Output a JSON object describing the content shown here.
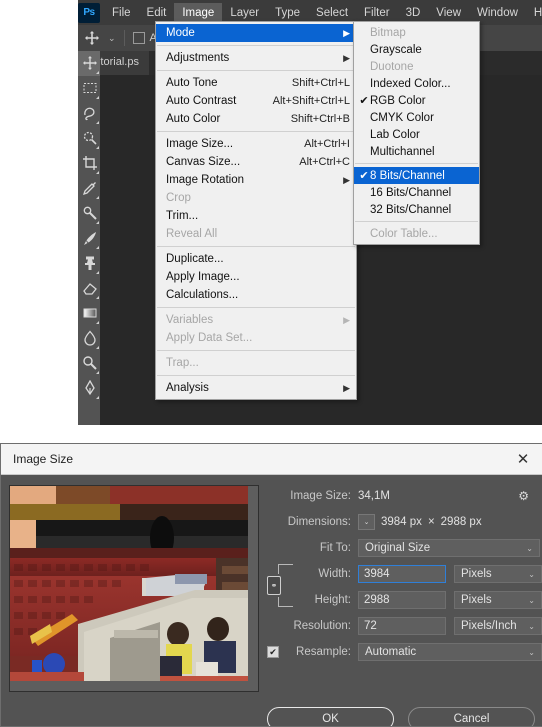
{
  "app": {
    "logo": "Ps",
    "menus": [
      "File",
      "Edit",
      "Image",
      "Layer",
      "Type",
      "Select",
      "Filter",
      "3D",
      "View",
      "Window",
      "Help"
    ],
    "active_menu": "Image"
  },
  "options_bar": {
    "tool_icon": "move-tool-icon",
    "preset_caret": "⌄",
    "auto_select_label": "Auto",
    "auto_select_checked": false
  },
  "document_tab": {
    "label": "Tutorial.ps"
  },
  "toolbar": {
    "tools": [
      {
        "name": "move-tool",
        "selected": true
      },
      {
        "name": "rectangular-marquee-tool",
        "selected": false
      },
      {
        "name": "lasso-tool",
        "selected": false
      },
      {
        "name": "quick-selection-tool",
        "selected": false
      },
      {
        "name": "crop-tool",
        "selected": false
      },
      {
        "name": "eyedropper-tool",
        "selected": false
      },
      {
        "name": "spot-healing-brush-tool",
        "selected": false
      },
      {
        "name": "brush-tool",
        "selected": false
      },
      {
        "name": "clone-stamp-tool",
        "selected": false
      },
      {
        "name": "eraser-tool",
        "selected": false
      },
      {
        "name": "gradient-tool",
        "selected": false
      },
      {
        "name": "blur-tool",
        "selected": false
      },
      {
        "name": "dodge-tool",
        "selected": false
      },
      {
        "name": "pen-tool",
        "selected": false
      }
    ]
  },
  "image_menu": {
    "items": [
      {
        "label": "Mode",
        "accel": "",
        "submenu": true,
        "disabled": false,
        "highlighted": true
      },
      {
        "sep": true
      },
      {
        "label": "Adjustments",
        "accel": "",
        "submenu": true,
        "disabled": false,
        "highlighted": false
      },
      {
        "sep": true
      },
      {
        "label": "Auto Tone",
        "accel": "Shift+Ctrl+L",
        "submenu": false,
        "disabled": false,
        "highlighted": false
      },
      {
        "label": "Auto Contrast",
        "accel": "Alt+Shift+Ctrl+L",
        "submenu": false,
        "disabled": false,
        "highlighted": false
      },
      {
        "label": "Auto Color",
        "accel": "Shift+Ctrl+B",
        "submenu": false,
        "disabled": false,
        "highlighted": false
      },
      {
        "sep": true
      },
      {
        "label": "Image Size...",
        "accel": "Alt+Ctrl+I",
        "submenu": false,
        "disabled": false,
        "highlighted": false
      },
      {
        "label": "Canvas Size...",
        "accel": "Alt+Ctrl+C",
        "submenu": false,
        "disabled": false,
        "highlighted": false
      },
      {
        "label": "Image Rotation",
        "accel": "",
        "submenu": true,
        "disabled": false,
        "highlighted": false
      },
      {
        "label": "Crop",
        "accel": "",
        "submenu": false,
        "disabled": true,
        "highlighted": false
      },
      {
        "label": "Trim...",
        "accel": "",
        "submenu": false,
        "disabled": false,
        "highlighted": false
      },
      {
        "label": "Reveal All",
        "accel": "",
        "submenu": false,
        "disabled": true,
        "highlighted": false
      },
      {
        "sep": true
      },
      {
        "label": "Duplicate...",
        "accel": "",
        "submenu": false,
        "disabled": false,
        "highlighted": false
      },
      {
        "label": "Apply Image...",
        "accel": "",
        "submenu": false,
        "disabled": false,
        "highlighted": false
      },
      {
        "label": "Calculations...",
        "accel": "",
        "submenu": false,
        "disabled": false,
        "highlighted": false
      },
      {
        "sep": true
      },
      {
        "label": "Variables",
        "accel": "",
        "submenu": true,
        "disabled": true,
        "highlighted": false
      },
      {
        "label": "Apply Data Set...",
        "accel": "",
        "submenu": false,
        "disabled": true,
        "highlighted": false
      },
      {
        "sep": true
      },
      {
        "label": "Trap...",
        "accel": "",
        "submenu": false,
        "disabled": true,
        "highlighted": false
      },
      {
        "sep": true
      },
      {
        "label": "Analysis",
        "accel": "",
        "submenu": true,
        "disabled": false,
        "highlighted": false
      }
    ]
  },
  "mode_submenu": {
    "items": [
      {
        "label": "Bitmap",
        "checked": false,
        "disabled": true,
        "highlighted": false
      },
      {
        "label": "Grayscale",
        "checked": false,
        "disabled": false,
        "highlighted": false
      },
      {
        "label": "Duotone",
        "checked": false,
        "disabled": true,
        "highlighted": false
      },
      {
        "label": "Indexed Color...",
        "checked": false,
        "disabled": false,
        "highlighted": false
      },
      {
        "label": "RGB Color",
        "checked": true,
        "disabled": false,
        "highlighted": false
      },
      {
        "label": "CMYK Color",
        "checked": false,
        "disabled": false,
        "highlighted": false
      },
      {
        "label": "Lab Color",
        "checked": false,
        "disabled": false,
        "highlighted": false
      },
      {
        "label": "Multichannel",
        "checked": false,
        "disabled": false,
        "highlighted": false
      },
      {
        "sep": true
      },
      {
        "label": "8 Bits/Channel",
        "checked": true,
        "disabled": false,
        "highlighted": true
      },
      {
        "label": "16 Bits/Channel",
        "checked": false,
        "disabled": false,
        "highlighted": false
      },
      {
        "label": "32 Bits/Channel",
        "checked": false,
        "disabled": false,
        "highlighted": false
      },
      {
        "sep": true
      },
      {
        "label": "Color Table...",
        "checked": false,
        "disabled": true,
        "highlighted": false
      }
    ],
    "check_glyph": "✔"
  },
  "dialog": {
    "title": "Image Size",
    "close_glyph": "✕",
    "gear_glyph": "⚙",
    "image_size_label": "Image Size:",
    "image_size_value": "34,1M",
    "dimensions_label": "Dimensions:",
    "dimensions_width": "3984 px",
    "dimensions_times": "×",
    "dimensions_height": "2988 px",
    "fit_to_label": "Fit To:",
    "fit_to_value": "Original Size",
    "width_label": "Width:",
    "width_value": "3984",
    "width_unit": "Pixels",
    "height_label": "Height:",
    "height_value": "2988",
    "height_unit": "Pixels",
    "resolution_label": "Resolution:",
    "resolution_value": "72",
    "resolution_unit": "Pixels/Inch",
    "resample_label": "Resample:",
    "resample_value": "Automatic",
    "resample_checked": true,
    "chain_glyph": "⚭",
    "caret_glyph": "⌄",
    "check_glyph": "✔",
    "ok_label": "OK",
    "cancel_label": "Cancel",
    "preview_alt": "stadium-seats-photo"
  },
  "colors": {
    "menu_highlight": "#0a64d2",
    "panel_bg": "#535353",
    "chrome_bg": "#323232",
    "field_border_focus": "#2f7fd8"
  }
}
